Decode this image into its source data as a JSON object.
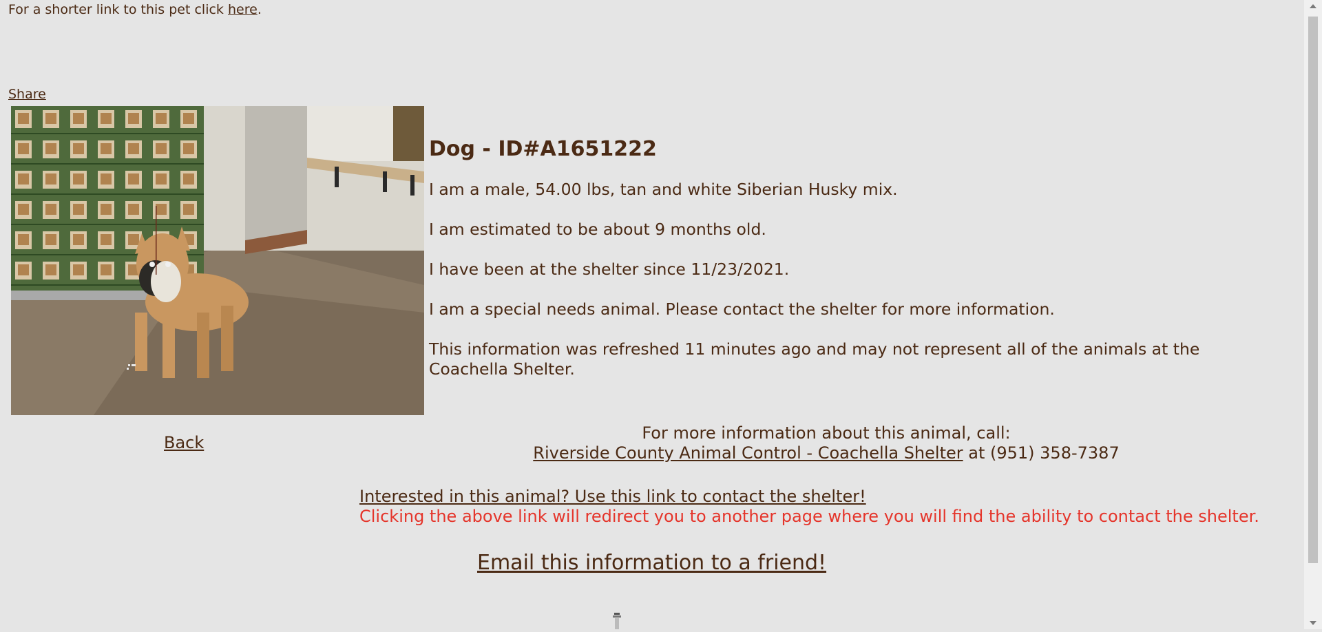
{
  "header": {
    "shortlink_prefix": "For a shorter link to this pet click ",
    "shortlink_link": "here",
    "shortlink_suffix": ".",
    "share_label": "Share"
  },
  "pet": {
    "title": "Dog - ID#A1651222",
    "details": [
      "I am a male, 54.00 lbs, tan and white Siberian Husky mix.",
      "I am estimated to be about 9 months old.",
      "I have been at the shelter since 11/23/2021.",
      "I am a special needs animal. Please contact the shelter for more information.",
      "This information was refreshed 11 minutes ago and may not represent all of the animals at the Coachella Shelter."
    ]
  },
  "nav": {
    "back_label": "Back"
  },
  "contact": {
    "call_prompt": "For more information about this animal, call:",
    "shelter_link": "Riverside County Animal Control - Coachella Shelter",
    "phone_text": " at (951) 358-7387",
    "interest_link": "Interested in this animal? Use this link to contact the shelter!",
    "redirect_note": "Clicking the above link will redirect you to another page where you will find the ability to contact the shelter."
  },
  "email": {
    "label": "Email this information to a friend!"
  },
  "colors": {
    "background": "#e5e5e5",
    "text": "#4b2a14",
    "warning": "#e5352b"
  }
}
